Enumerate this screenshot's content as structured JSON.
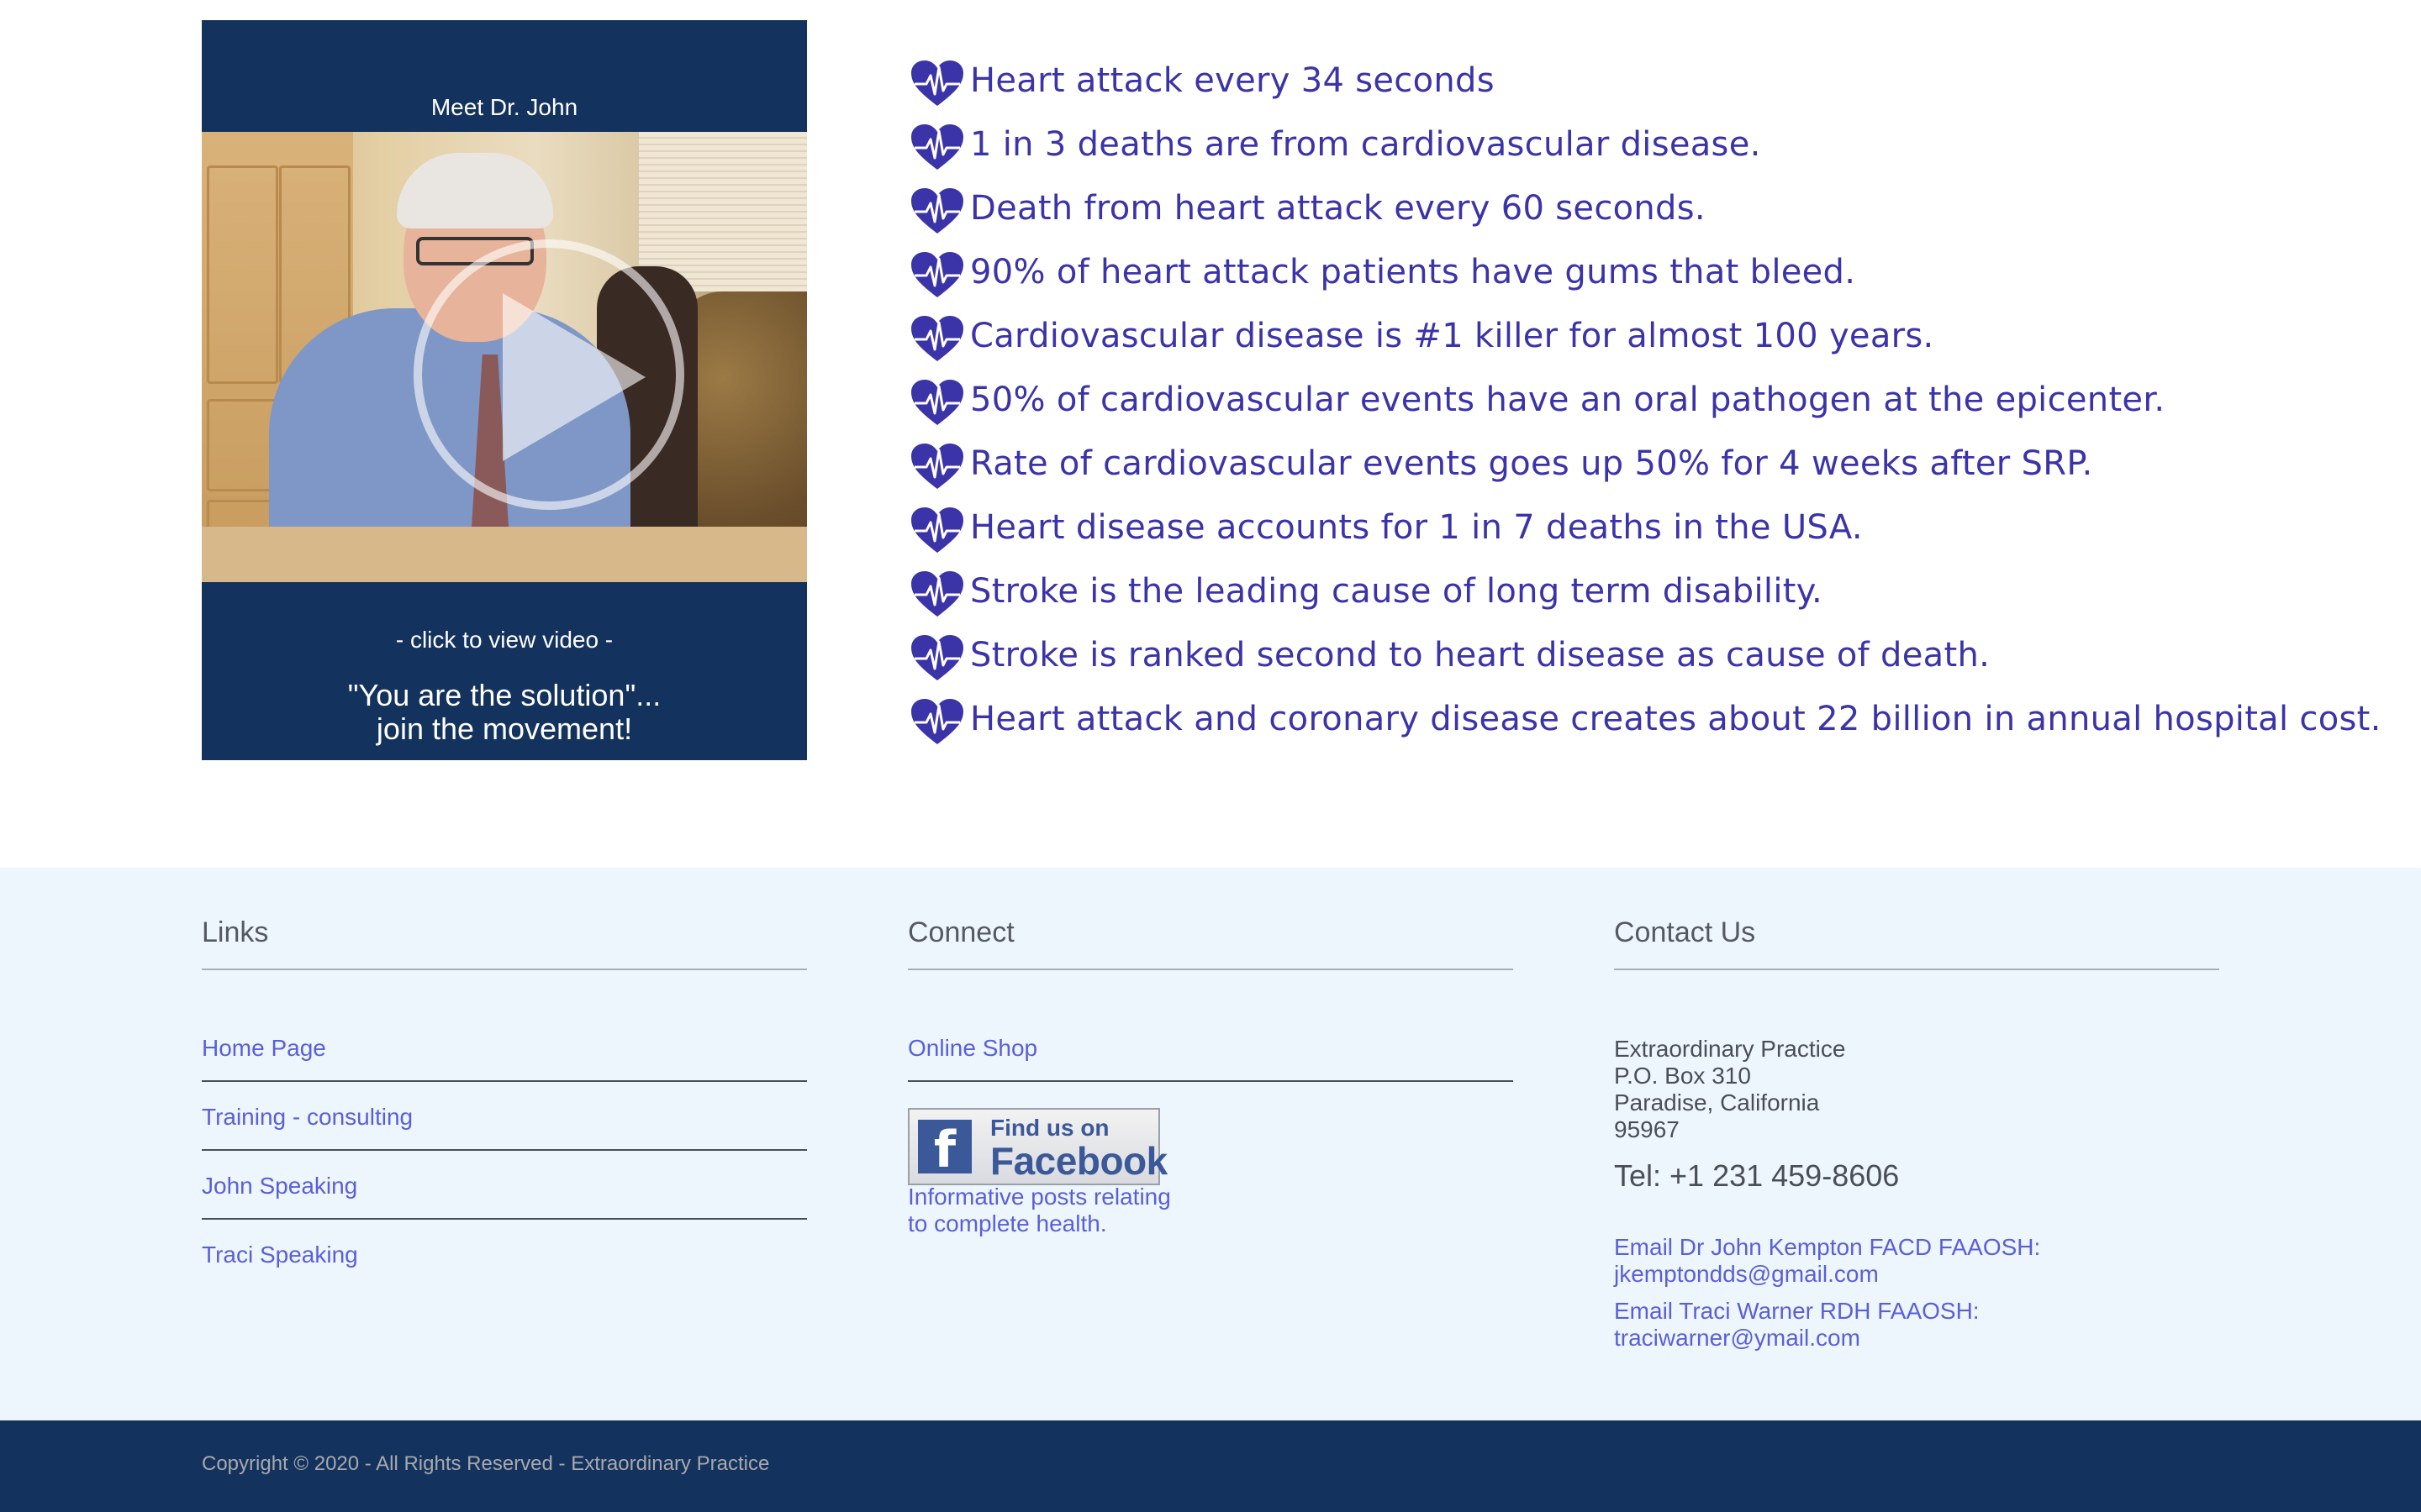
{
  "video": {
    "heading": "Meet Dr. John",
    "click_label": "- click to view video -",
    "quote_line1": "\"You are the solution\"...",
    "quote_line2": "join the movement!",
    "play_icon": "play-icon"
  },
  "facts": {
    "icon": "heart-pulse-icon",
    "accent": "#3b33a8",
    "items": [
      "Heart attack every 34 seconds",
      "1 in 3 deaths are from cardiovascular disease.",
      "Death from heart attack every 60 seconds.",
      "90% of heart attack patients have gums that bleed.",
      "Cardiovascular disease is #1 killer for almost 100 years.",
      "50% of cardiovascular events have an oral pathogen at the epicenter.",
      "Rate of cardiovascular events goes up 50% for 4 weeks after SRP.",
      "Heart disease accounts for 1 in 7 deaths in the USA.",
      "Stroke is the leading cause of long term disability.",
      "Stroke is ranked second to heart disease as cause of death.",
      "Heart attack and coronary disease creates about 22 billion in annual hospital cost."
    ]
  },
  "footer": {
    "links": {
      "title": "Links",
      "items": [
        "Home Page",
        "Training - consulting",
        "John Speaking",
        "Traci Speaking"
      ]
    },
    "connect": {
      "title": "Connect",
      "shop_link": "Online Shop",
      "facebook_find": "Find us on",
      "facebook_name": "Facebook",
      "facebook_caption_line1": "Informative posts relating",
      "facebook_caption_line2": "to complete health."
    },
    "contact": {
      "title": "Contact Us",
      "address_lines": [
        "Extraordinary Practice",
        "P.O. Box 310",
        "Paradise, California",
        "95967"
      ],
      "tel": "Tel: +1 231 459-8606",
      "email1_label": "Email Dr John Kempton FACD FAAOSH:",
      "email1": "jkemptondds@gmail.com",
      "email2_label": "Email Traci Warner RDH FAAOSH:",
      "email2": "traciwarner@ymail.com"
    },
    "copyright": "Copyright © 2020 - All Rights Reserved - Extraordinary Practice"
  },
  "colors": {
    "navy": "#13325e",
    "link": "#5a5fd8",
    "footer_bg": "#eef6fd"
  }
}
